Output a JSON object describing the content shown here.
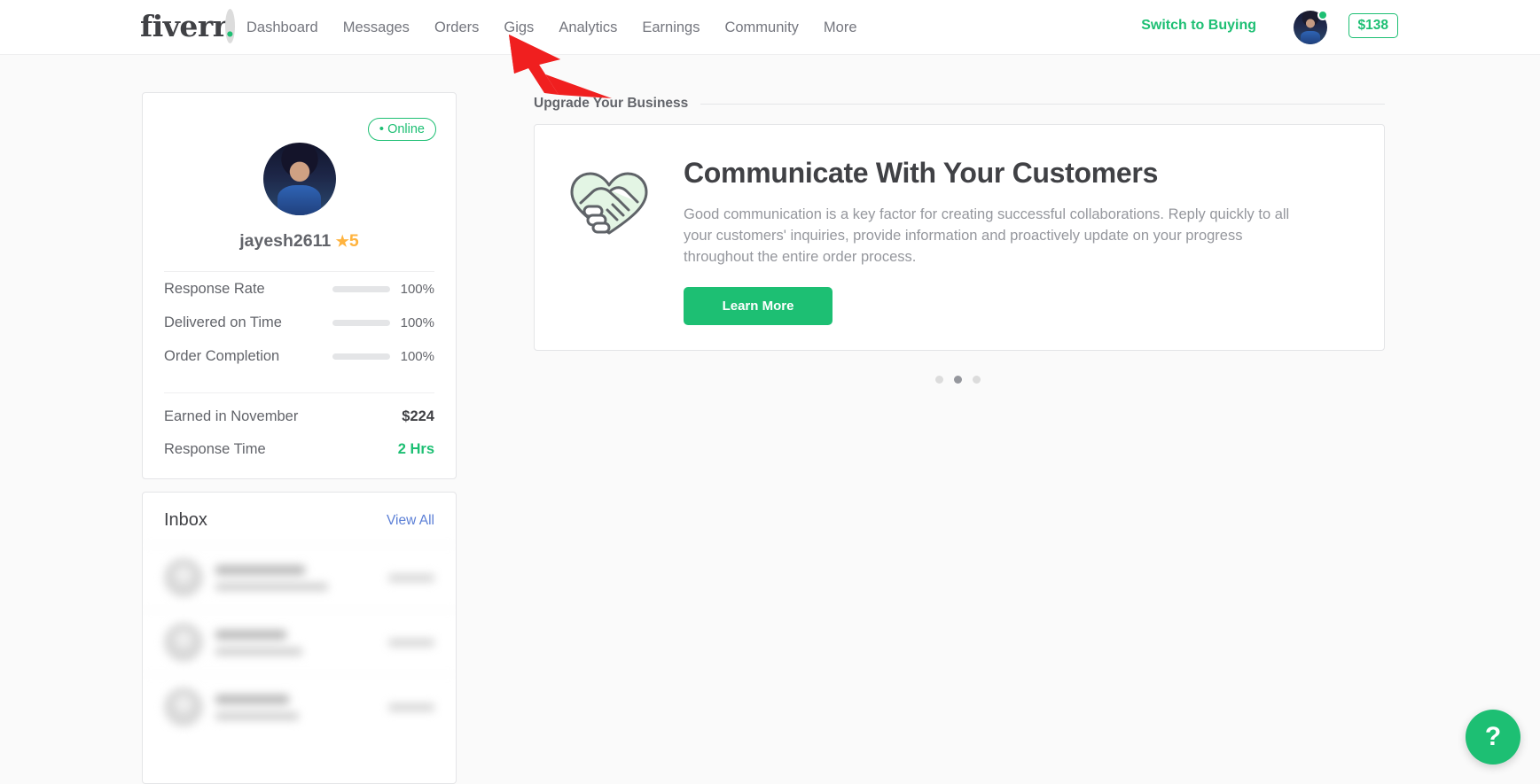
{
  "header": {
    "logo": "fiverr",
    "nav": [
      {
        "label": "Dashboard"
      },
      {
        "label": "Messages"
      },
      {
        "label": "Orders"
      },
      {
        "label": "Gigs"
      },
      {
        "label": "Analytics"
      },
      {
        "label": "Earnings"
      },
      {
        "label": "Community"
      },
      {
        "label": "More"
      }
    ],
    "switch_label": "Switch to Buying",
    "balance": "$138"
  },
  "profile": {
    "status": "Online",
    "status_pip": "•",
    "username": "jayesh2611",
    "star": "★",
    "rating": "5",
    "stats": [
      {
        "label": "Response Rate",
        "value": "100%",
        "percent": 100
      },
      {
        "label": "Delivered on Time",
        "value": "100%",
        "percent": 100
      },
      {
        "label": "Order Completion",
        "value": "100%",
        "percent": 100
      }
    ],
    "earned_label": "Earned in November",
    "earned_value": "$224",
    "response_time_label": "Response Time",
    "response_time_value": "2 Hrs"
  },
  "inbox": {
    "title": "Inbox",
    "view_all": "View All",
    "messages": [
      {
        "name": "",
        "snippet": "",
        "time": ""
      },
      {
        "name": "",
        "snippet": "",
        "time": ""
      },
      {
        "name": "",
        "snippet": "",
        "time": ""
      }
    ]
  },
  "main": {
    "section_title": "Upgrade Your Business",
    "promo": {
      "icon": "handshake-heart-icon",
      "title": "Communicate With Your Customers",
      "text": "Good communication is a key factor for creating successful collaborations. Reply quickly to all your customers' inquiries, provide information and proactively update on your progress throughout the entire order process.",
      "button": "Learn More"
    },
    "carousel": {
      "total": 3,
      "active_index": 1
    }
  },
  "help": {
    "icon": "question-mark-icon",
    "label": "?"
  },
  "annotation": {
    "arrow_color": "#f01f1f",
    "points_at": "Gigs"
  },
  "colors": {
    "brand_green": "#1dbf73",
    "text_dark": "#404145",
    "text_muted": "#62646a",
    "text_light": "#95979d",
    "link_blue": "#5b7fd6",
    "star_orange": "#ffb33e",
    "border": "#e4e5e7",
    "page_bg": "#fafafa"
  }
}
